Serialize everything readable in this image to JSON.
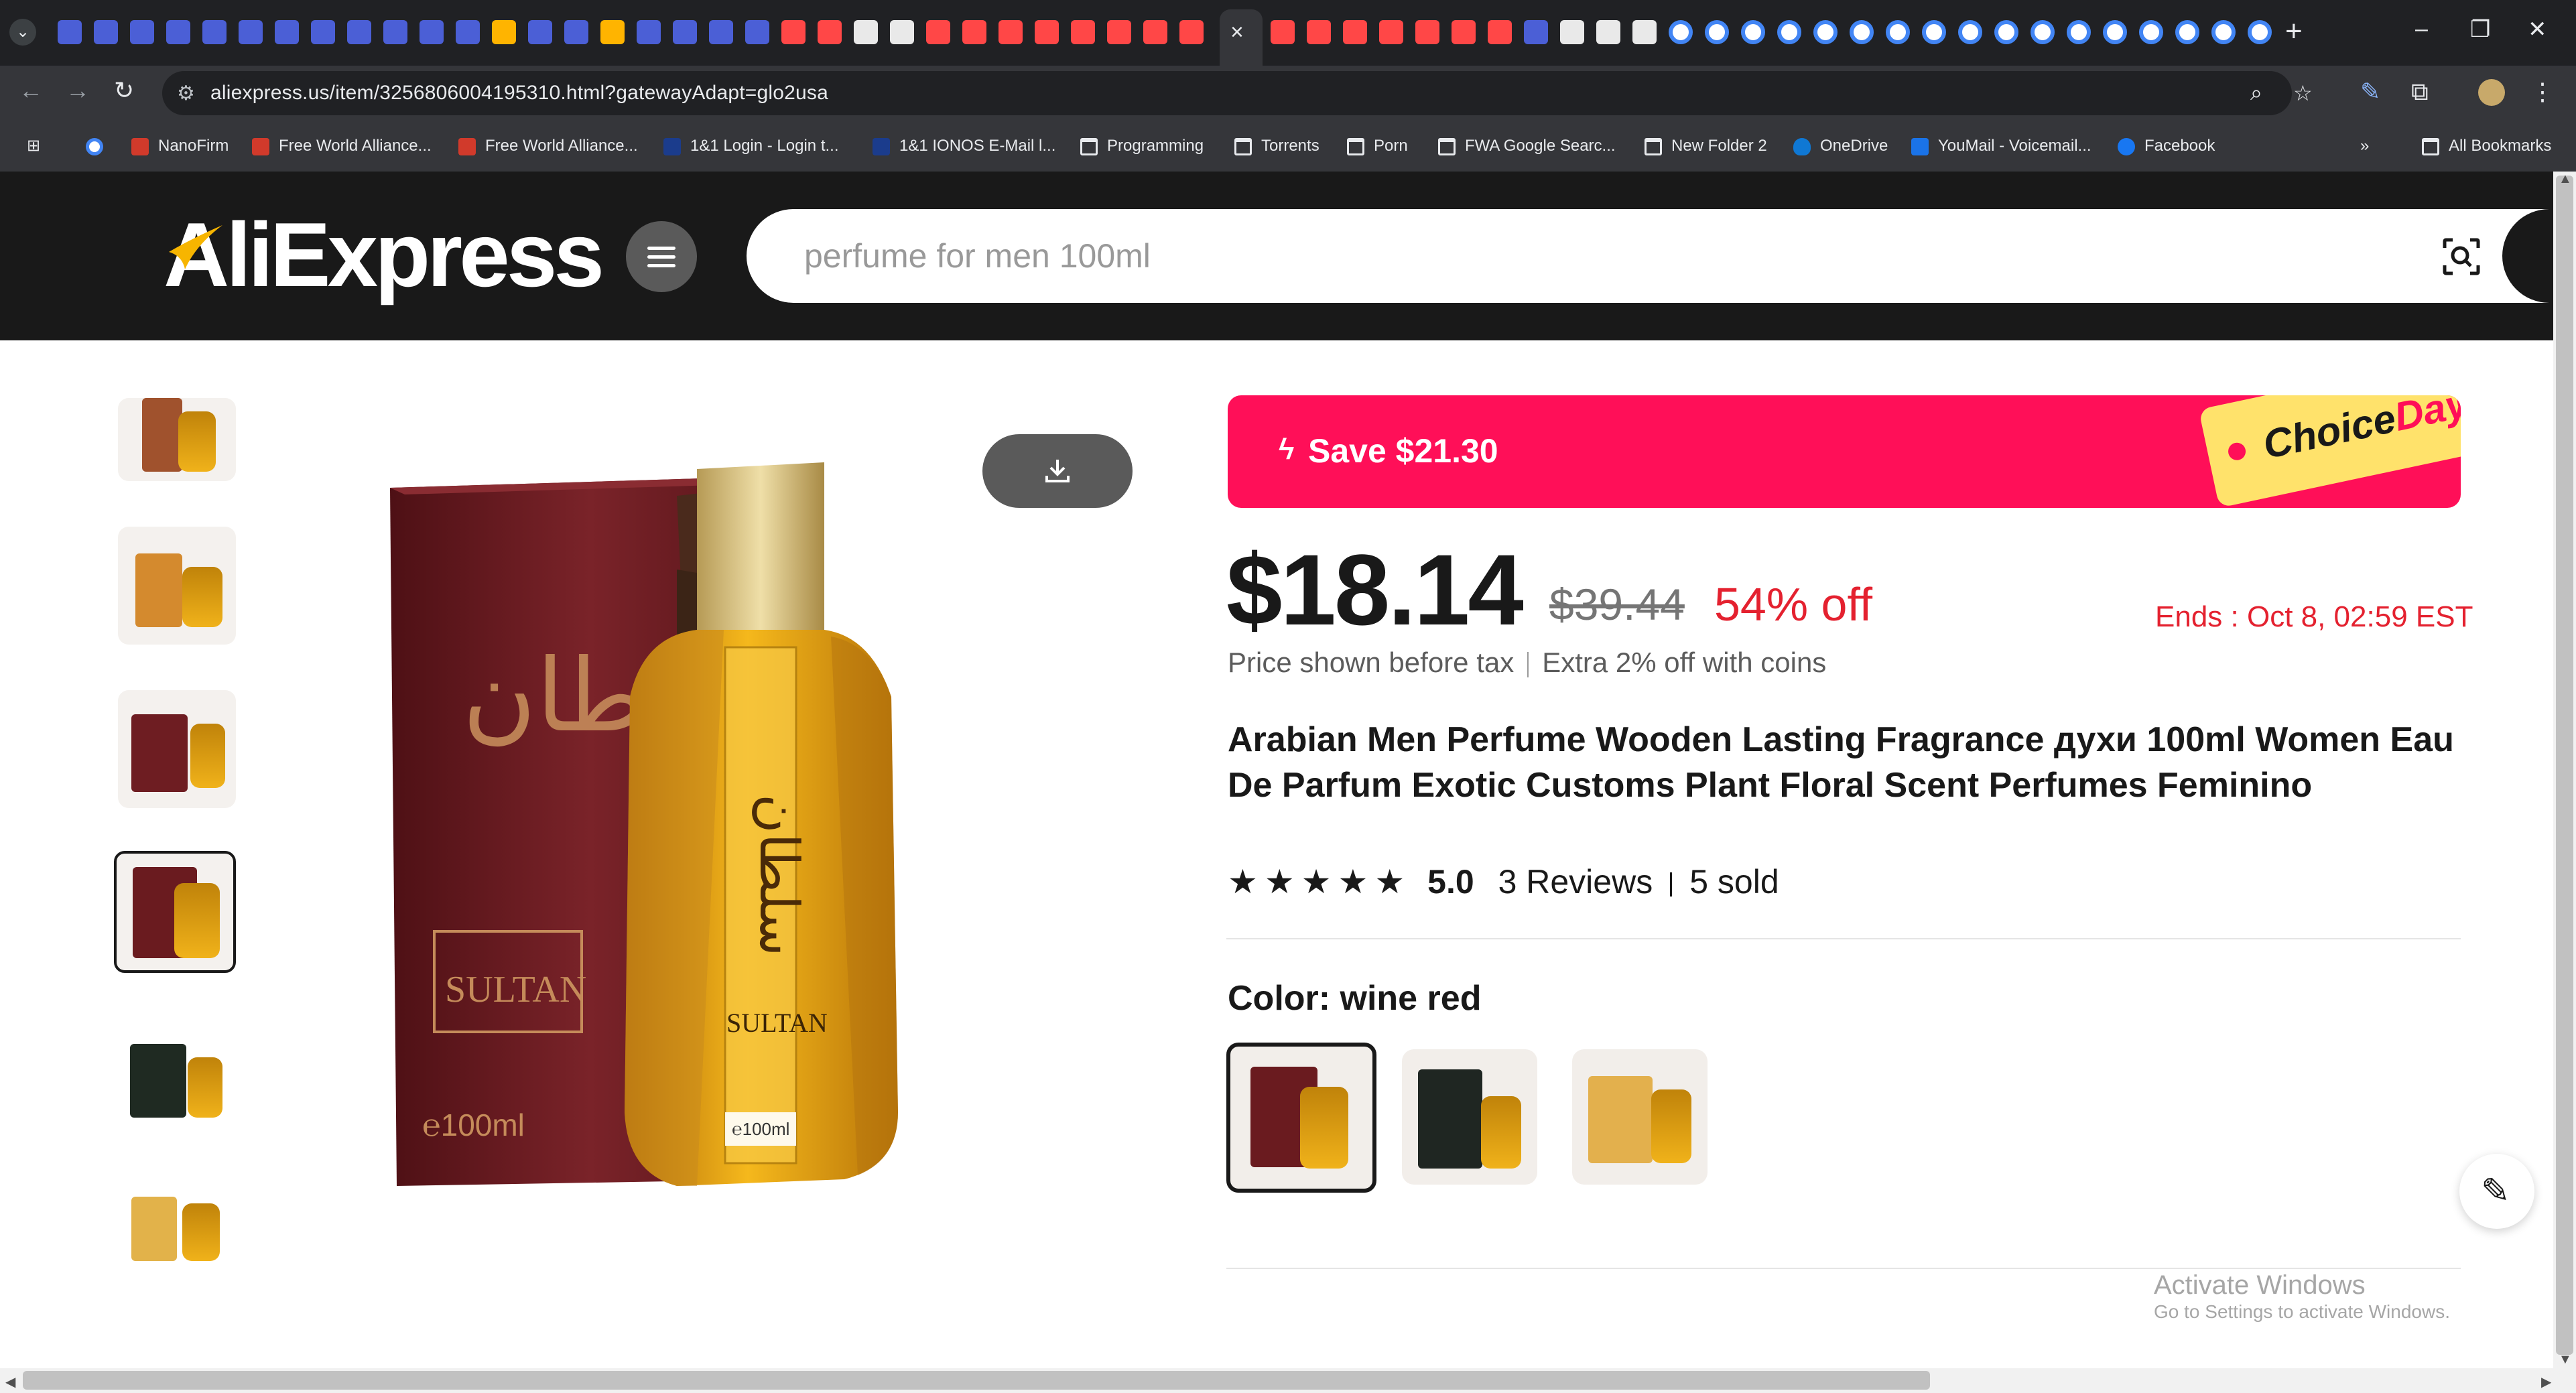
{
  "browser": {
    "url": "aliexpress.us/item/3256806004195310.html?gatewayAdapt=glo2usa",
    "bookmarks": [
      {
        "label": "NanoFirm",
        "icon": "nanofirm-icon"
      },
      {
        "label": "Free World Alliance...",
        "icon": "nanofirm-icon"
      },
      {
        "label": "Free World Alliance...",
        "icon": "nanofirm-icon"
      },
      {
        "label": "1&1 Login - Login t...",
        "icon": "ionos-icon"
      },
      {
        "label": "1&1 IONOS E-Mail l...",
        "icon": "ionos-icon"
      },
      {
        "label": "Programming",
        "icon": "folder-icon"
      },
      {
        "label": "Torrents",
        "icon": "folder-icon"
      },
      {
        "label": "Porn",
        "icon": "folder-icon"
      },
      {
        "label": "FWA Google Searc...",
        "icon": "folder-icon"
      },
      {
        "label": "New Folder 2",
        "icon": "folder-icon"
      },
      {
        "label": "OneDrive",
        "icon": "onedrive-icon"
      },
      {
        "label": "YouMail - Voicemail...",
        "icon": "youmail-icon"
      },
      {
        "label": "Facebook",
        "icon": "facebook-icon"
      }
    ],
    "all_bookmarks": "All Bookmarks",
    "overflow": "»"
  },
  "site": {
    "logo": "AliExpress",
    "search_placeholder": "perfume for men 100ml",
    "accent": "#ff0f58",
    "header_bg": "#191919"
  },
  "product": {
    "promo_label": "Save $21.30",
    "promo_badge_1": "Choice",
    "promo_badge_2": "Day",
    "price": "$18.14",
    "original_price": "$39.44",
    "discount": "54% off",
    "ends": "Ends :  Oct 8, 02:59 EST",
    "tax_note": "Price shown before tax",
    "coins_note": "Extra 2% off with coins",
    "title": "Arabian Men Perfume Wooden Lasting Fragrance духи 100ml Women Eau De Parfum Exotic Customs Plant Floral Scent Perfumes Feminino",
    "rating": "5.0",
    "stars": 5,
    "reviews": "3 Reviews",
    "sold": "5 sold",
    "color_label": "Color: wine red",
    "colors": [
      "wine red",
      "black",
      "gold"
    ],
    "image_text": {
      "brand": "SULTAN",
      "size": "℮100ml",
      "arabic": "سلطان"
    }
  },
  "os": {
    "activate_title": "Activate Windows",
    "activate_sub": "Go to Settings to activate Windows."
  }
}
